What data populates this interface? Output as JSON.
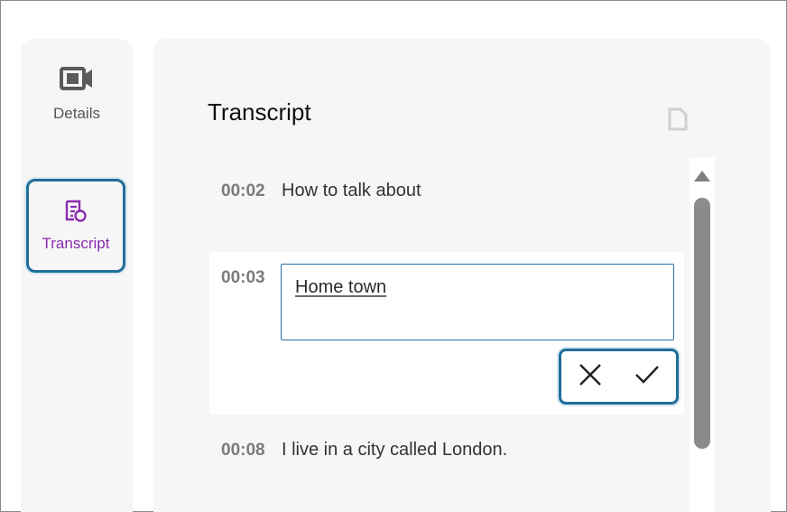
{
  "sidebar": {
    "items": [
      {
        "label": "Details",
        "icon": "video-camera-icon",
        "active": false
      },
      {
        "label": "Transcript",
        "icon": "transcript-icon",
        "active": true
      }
    ],
    "active_color": "#8b2bb0",
    "highlight_color": "#1f6e9b"
  },
  "main": {
    "title": "Transcript",
    "entries": [
      {
        "time": "00:02",
        "text": "How to talk about"
      },
      {
        "time": "00:03",
        "text": "Home town",
        "editing": true
      },
      {
        "time": "00:08",
        "text": "I live in a city called London."
      }
    ],
    "edit_actions": {
      "cancel_icon": "close-icon",
      "confirm_icon": "checkmark-icon"
    }
  }
}
